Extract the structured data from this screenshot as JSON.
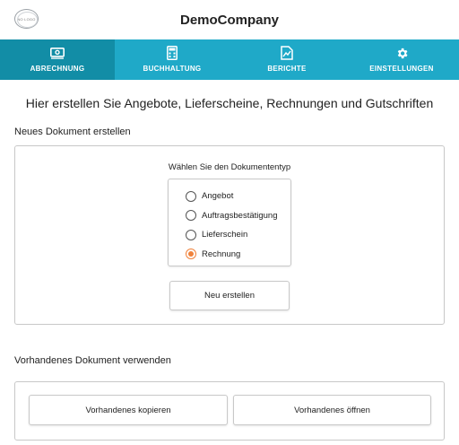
{
  "header": {
    "logo_text": "NO LOGO",
    "company": "DemoCompany"
  },
  "nav": {
    "items": [
      {
        "label": "ABRECHNUNG",
        "icon": "money-icon",
        "active": true
      },
      {
        "label": "BUCHHALTUNG",
        "icon": "calculator-icon",
        "active": false
      },
      {
        "label": "BERICHTE",
        "icon": "report-chart-icon",
        "active": false
      },
      {
        "label": "EINSTELLUNGEN",
        "icon": "gear-icon",
        "active": false
      }
    ]
  },
  "main": {
    "headline": "Hier erstellen Sie Angebote, Lieferscheine, Rechnungen und Gutschriften",
    "new_document": {
      "title": "Neues Dokument erstellen",
      "type_label": "Wählen Sie den Dokumententyp",
      "options": [
        {
          "label": "Angebot",
          "checked": false
        },
        {
          "label": "Auftragsbestätigung",
          "checked": false
        },
        {
          "label": "Lieferschein",
          "checked": false
        },
        {
          "label": "Rechnung",
          "checked": true
        }
      ],
      "create_button": "Neu erstellen"
    },
    "existing_document": {
      "title": "Vorhandenes Dokument verwenden",
      "copy_button": "Vorhandenes kopieren",
      "open_button": "Vorhandenes öffnen"
    }
  },
  "colors": {
    "nav_bg": "#1fa9c8",
    "nav_active": "#128da6",
    "radio_accent": "#f0823b"
  }
}
